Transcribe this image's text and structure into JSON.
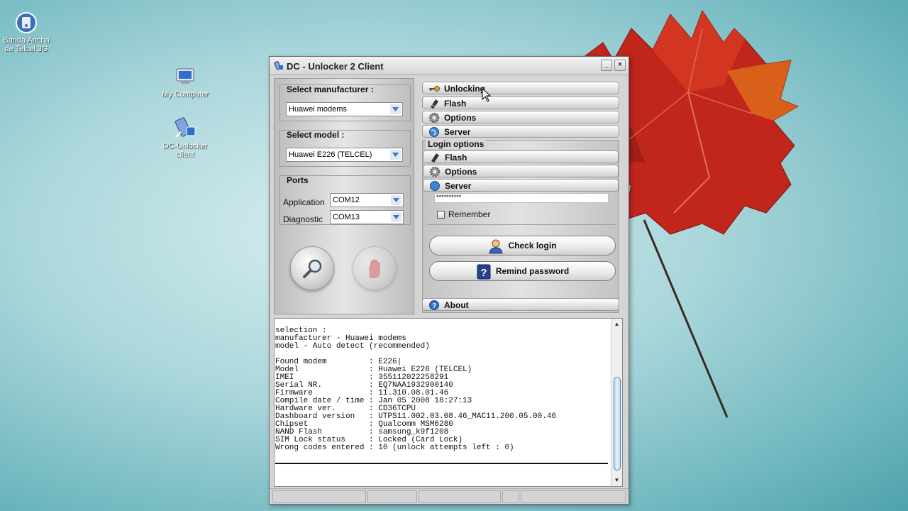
{
  "desktop": {
    "icons": [
      {
        "label": "Banda Ancha de Telcel 3G",
        "icon": "modem-icon"
      },
      {
        "label": "My Computer",
        "icon": "computer-icon"
      },
      {
        "label": "DC-Unlocker client",
        "icon": "dc-unlocker-icon"
      }
    ]
  },
  "window": {
    "title": "DC - Unlocker 2 Client",
    "minimize_label": "_",
    "close_label": "×"
  },
  "left": {
    "manufacturer_title": "Select manufacturer :",
    "manufacturer_value": "Huawei modems",
    "model_title": "Select model :",
    "model_value": "Huawei E226 (TELCEL)",
    "ports_title": "Ports",
    "application_label": "Application",
    "application_value": "COM12",
    "diagnostic_label": "Diagnostic",
    "diagnostic_value": "COM13",
    "search_button_icon": "magnifier-icon",
    "stop_button_icon": "stop-hand-icon"
  },
  "right": {
    "tabs_top": [
      {
        "label": "Unlocking",
        "icon": "key-icon"
      },
      {
        "label": "Flash",
        "icon": "chip-icon"
      },
      {
        "label": "Options",
        "icon": "gear-icon"
      },
      {
        "label": "Server",
        "icon": "globe-icon"
      }
    ],
    "login_options_label": "Login options",
    "tabs_mid": [
      {
        "label": "Flash",
        "icon": "chip-icon"
      },
      {
        "label": "Options",
        "icon": "gear-icon"
      },
      {
        "label": "Server",
        "icon": "globe-icon"
      }
    ],
    "password_masked": "**********",
    "remember_label": "Remember",
    "check_login_label": "Check login",
    "remind_password_label": "Remind password",
    "about_label": "About"
  },
  "log": {
    "lines": "selection :\nmanufacturer - Huawei modems\nmodel - Auto detect (recommended)\n\nFound modem         : E226|\nModel               : Huawei E226 (TELCEL)\nIMEI                : 355112022258291\nSerial NR.          : EQ7NAA1932900140\nFirmware            : 11.310.08.01.46\nCompile date / time : Jan 05 2008 18:27:13\nHardware ver.       : CD36TCPU\nDashboard version   : UTPS11.002.03.08.46_MAC11.200.05.00.46\nChipset             : Qualcomm MSM6280\nNAND Flash          : samsung_k9f1208\nSIM Lock status     : Locked (Card Lock)\nWrong codes entered : 10 (unlock attempts left : 0)"
  },
  "colors": {
    "desktop_bg": "#8cc6cc",
    "window_bg": "#d4d4d4",
    "scroll_thumb": "#4a86c8"
  }
}
